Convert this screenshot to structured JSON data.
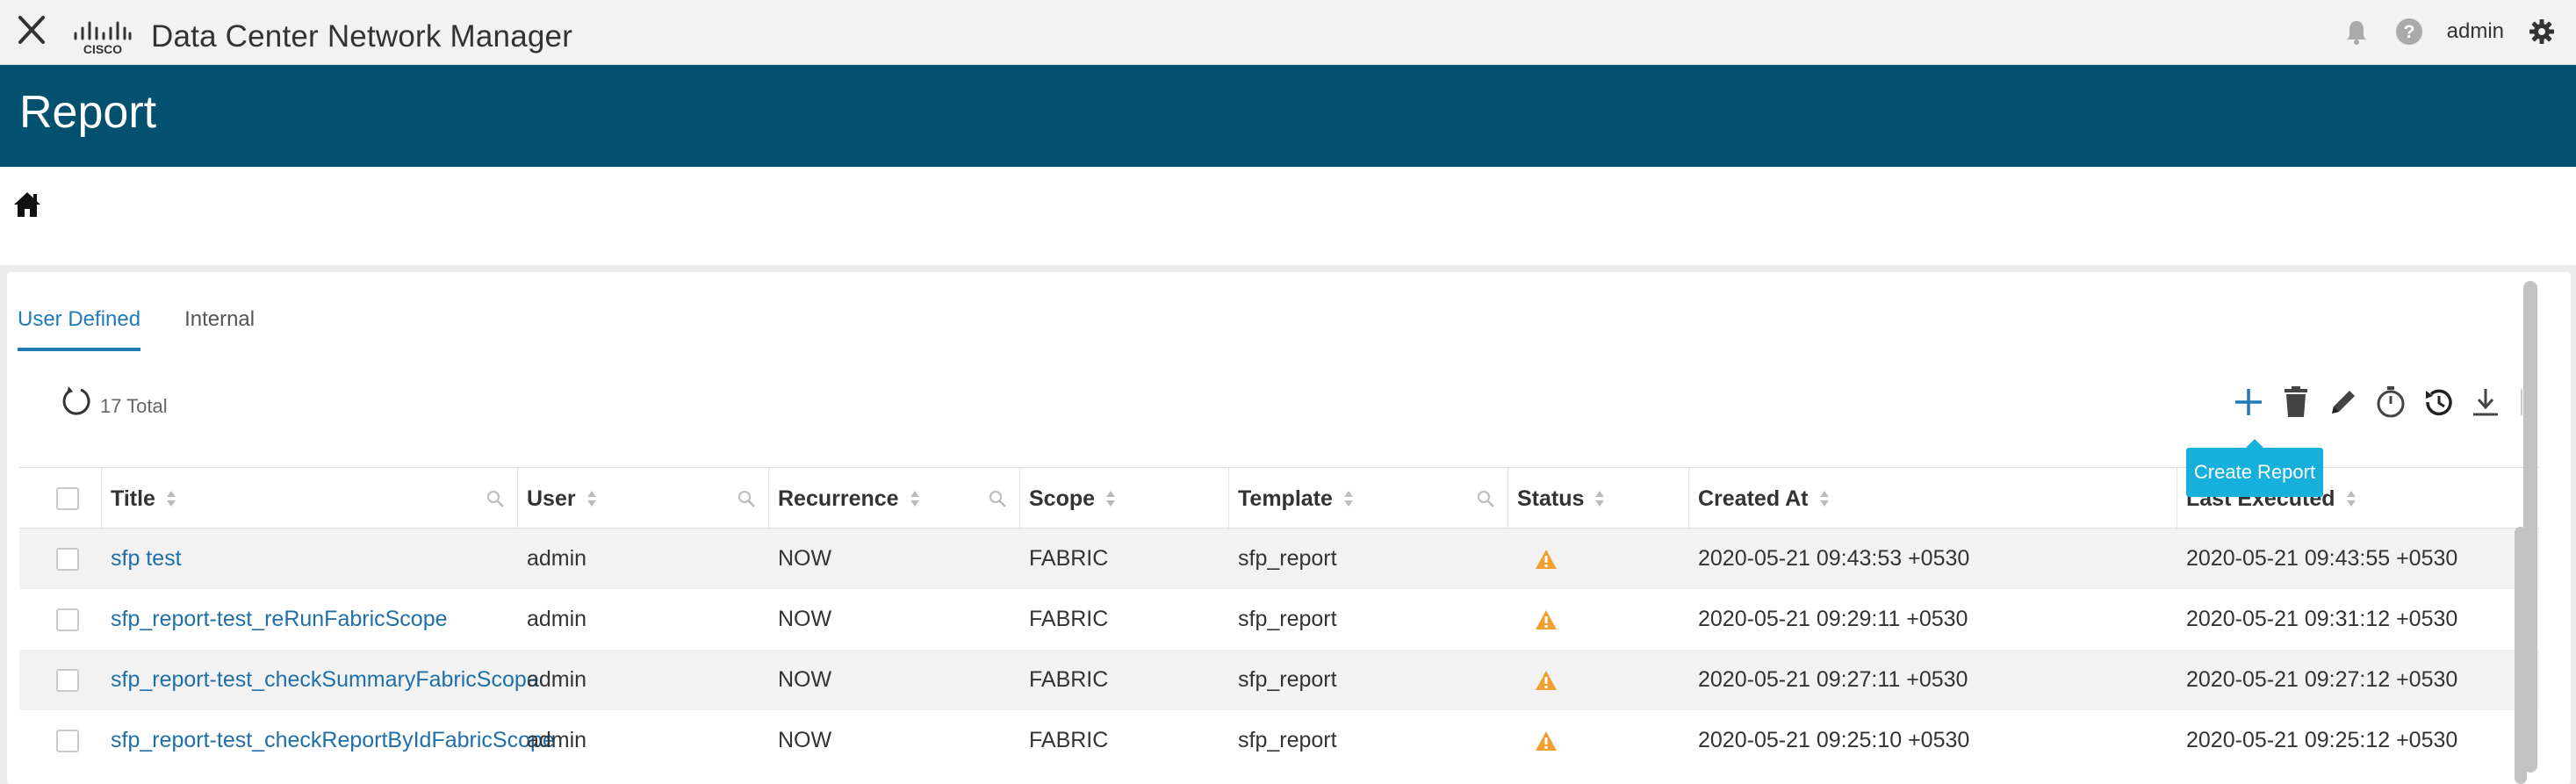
{
  "app": {
    "logo_text": "CISCO",
    "title": "Data Center Network Manager",
    "user": "admin"
  },
  "page": {
    "title": "Report"
  },
  "tabs": [
    {
      "label": "User Defined",
      "active": true
    },
    {
      "label": "Internal",
      "active": false
    }
  ],
  "summary": {
    "total_label": "17 Total"
  },
  "toolbar": {
    "create_tooltip": "Create Report",
    "icons": [
      "plus-icon",
      "trash-icon",
      "pencil-icon",
      "timer-icon",
      "history-icon",
      "download-icon"
    ]
  },
  "colors": {
    "banner": "#04506f",
    "link": "#1f6fa8",
    "accent": "#1f7bb8",
    "tooltip": "#16b0dd",
    "warning": "#f0a030"
  },
  "table": {
    "columns": [
      "Title",
      "User",
      "Recurrence",
      "Scope",
      "Template",
      "Status",
      "Created At",
      "Last Executed"
    ],
    "rows": [
      {
        "title": "sfp test",
        "user": "admin",
        "recurrence": "NOW",
        "scope": "FABRIC",
        "template": "sfp_report",
        "status": "warning",
        "created": "2020-05-21 09:43:53 +0530",
        "executed": "2020-05-21 09:43:55 +0530"
      },
      {
        "title": "sfp_report-test_reRunFabricScope",
        "user": "admin",
        "recurrence": "NOW",
        "scope": "FABRIC",
        "template": "sfp_report",
        "status": "warning",
        "created": "2020-05-21 09:29:11 +0530",
        "executed": "2020-05-21 09:31:12 +0530"
      },
      {
        "title": "sfp_report-test_checkSummaryFabricScope",
        "user": "admin",
        "recurrence": "NOW",
        "scope": "FABRIC",
        "template": "sfp_report",
        "status": "warning",
        "created": "2020-05-21 09:27:11 +0530",
        "executed": "2020-05-21 09:27:12 +0530"
      },
      {
        "title": "sfp_report-test_checkReportByIdFabricScope",
        "user": "admin",
        "recurrence": "NOW",
        "scope": "FABRIC",
        "template": "sfp_report",
        "status": "warning",
        "created": "2020-05-21 09:25:10 +0530",
        "executed": "2020-05-21 09:25:12 +0530"
      }
    ]
  }
}
